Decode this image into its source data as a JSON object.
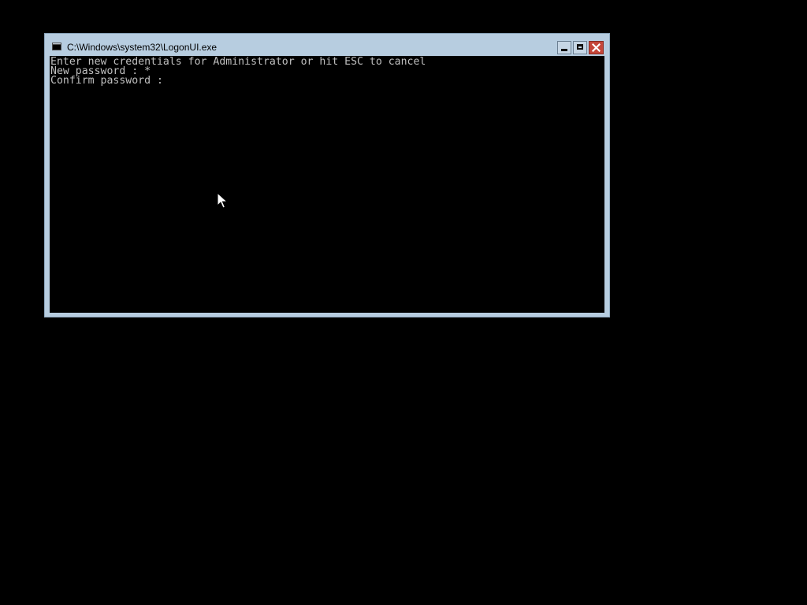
{
  "window": {
    "title": "C:\\Windows\\system32\\LogonUI.exe",
    "icon": "console-icon",
    "controls": {
      "minimize_icon": "minimize-icon",
      "maximize_icon": "maximize-icon",
      "close_icon": "close-icon",
      "close_color": "#c4463a"
    },
    "frame_color": "#b7cde0"
  },
  "console": {
    "background": "#000000",
    "text_color": "#c0c0c0",
    "lines": [
      "Enter new credentials for Administrator or hit ESC to cancel",
      "New password : *",
      "Confirm password :"
    ]
  },
  "cursor": {
    "icon": "mouse-pointer-icon"
  }
}
